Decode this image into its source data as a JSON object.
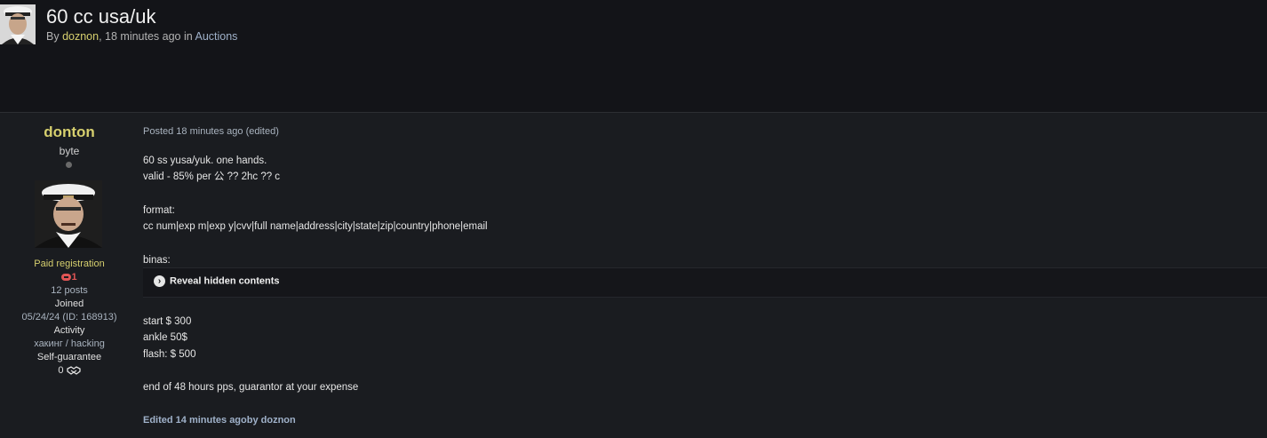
{
  "topic": {
    "title": "60 cc usa/uk",
    "by_prefix": "By ",
    "author": "doznon",
    "time_and_in": ", 18 minutes ago in ",
    "forum": "Auctions"
  },
  "user": {
    "name": "donton",
    "rank": "byte",
    "group": "Paid registration",
    "reputation": "1",
    "posts": "12 posts",
    "joined_label": "Joined",
    "joined_value": "05/24/24 (ID: 168913)",
    "activity_label": "Activity",
    "activity_value": "хакинг / hacking",
    "guarantee_label": "Self-guarantee",
    "guarantee_value": "0"
  },
  "post": {
    "meta": "Posted 18 minutes ago (edited)",
    "lines": [
      "60 ss yusa/yuk. one hands.",
      "valid - 85% per 公 ?? 2hc ?? c",
      "format:",
      "cc num|exp m|exp y|cvv|full name|address|city|state|zip|country|phone|email",
      "binas:",
      "start $ 300",
      "ankle 50$",
      "flash: $ 500",
      "end of 48 hours pps, guarantor at your expense"
    ],
    "spoiler_label": "Reveal hidden contents",
    "edited_note": "Edited 14 minutes agoby doznon"
  },
  "icons": {
    "reputation": "minus-circle-icon",
    "guarantee": "handshake-icon",
    "spoiler": "chevron-right-icon"
  },
  "colors": {
    "username": "#d6cf6e",
    "link": "#9fb1c9",
    "negative": "#e05555",
    "background": "#131418"
  }
}
